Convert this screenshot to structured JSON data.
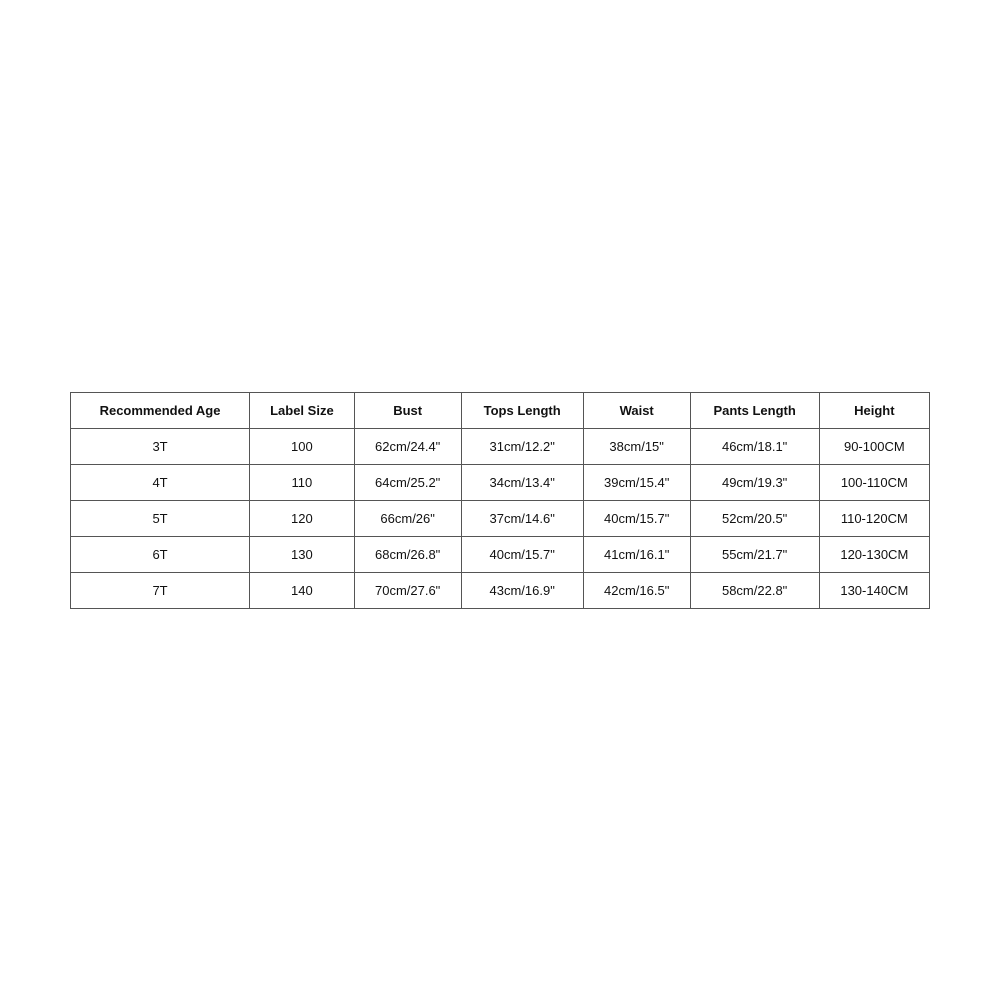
{
  "table": {
    "headers": [
      "Recommended Age",
      "Label Size",
      "Bust",
      "Tops Length",
      "Waist",
      "Pants Length",
      "Height"
    ],
    "rows": [
      {
        "recommended_age": "3T",
        "label_size": "100",
        "bust": "62cm/24.4\"",
        "tops_length": "31cm/12.2\"",
        "waist": "38cm/15\"",
        "pants_length": "46cm/18.1\"",
        "height": "90-100CM"
      },
      {
        "recommended_age": "4T",
        "label_size": "110",
        "bust": "64cm/25.2\"",
        "tops_length": "34cm/13.4\"",
        "waist": "39cm/15.4\"",
        "pants_length": "49cm/19.3\"",
        "height": "100-110CM"
      },
      {
        "recommended_age": "5T",
        "label_size": "120",
        "bust": "66cm/26\"",
        "tops_length": "37cm/14.6\"",
        "waist": "40cm/15.7\"",
        "pants_length": "52cm/20.5\"",
        "height": "110-120CM"
      },
      {
        "recommended_age": "6T",
        "label_size": "130",
        "bust": "68cm/26.8\"",
        "tops_length": "40cm/15.7\"",
        "waist": "41cm/16.1\"",
        "pants_length": "55cm/21.7\"",
        "height": "120-130CM"
      },
      {
        "recommended_age": "7T",
        "label_size": "140",
        "bust": "70cm/27.6\"",
        "tops_length": "43cm/16.9\"",
        "waist": "42cm/16.5\"",
        "pants_length": "58cm/22.8\"",
        "height": "130-140CM"
      }
    ]
  }
}
